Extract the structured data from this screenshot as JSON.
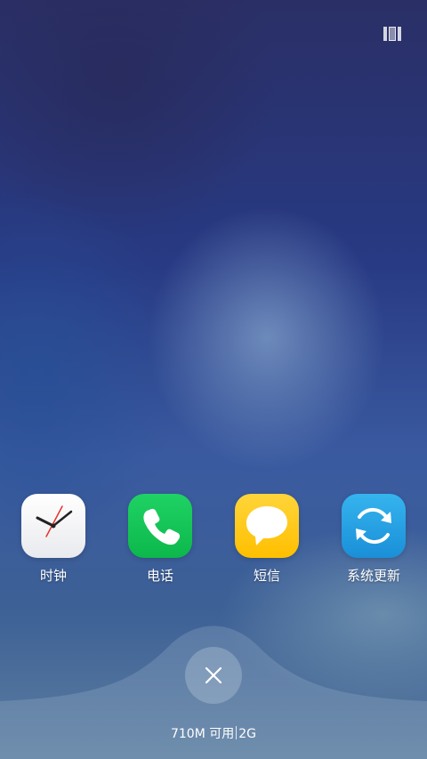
{
  "header": {
    "layout_toggle_icon": "multi-window-layout-icon"
  },
  "recent_apps": [
    {
      "label": "时钟",
      "icon": "clock-icon",
      "color": "#ffffff"
    },
    {
      "label": "电话",
      "icon": "phone-icon",
      "color": "#13c456"
    },
    {
      "label": "短信",
      "icon": "message-bubble-icon",
      "color": "#ffc600"
    },
    {
      "label": "系统更新",
      "icon": "sync-icon",
      "color": "#25a2e6"
    }
  ],
  "dock": {
    "close_icon": "close-icon",
    "memory_value": "710M",
    "memory_suffix": "可用",
    "total_memory": "2G"
  }
}
